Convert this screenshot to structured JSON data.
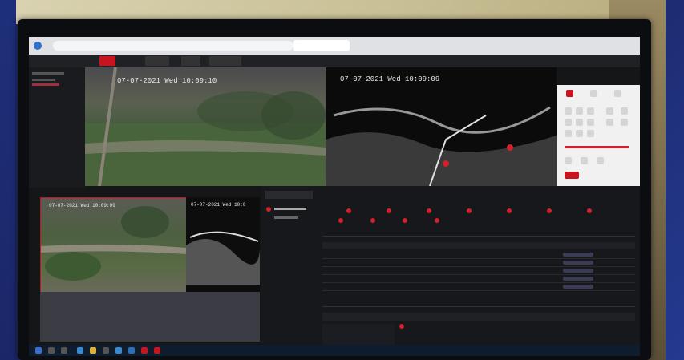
{
  "timestamps": {
    "top_left": "07-07-2021 Wed 10:09:10",
    "top_right": "07-07-2021 Wed 10:09:09",
    "bottom_left": "07-07-2021 Wed 10:09:09",
    "bottom_right": "07-07-2021 Wed 10:0"
  },
  "colors": {
    "accent": "#c8141e",
    "screen_bg": "#151618"
  }
}
